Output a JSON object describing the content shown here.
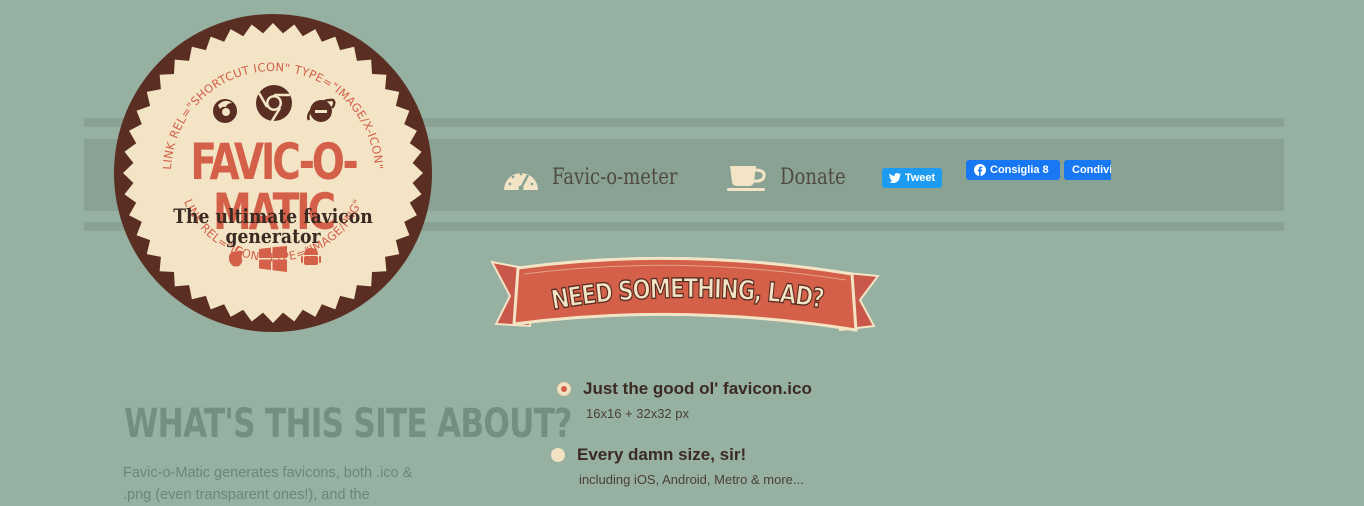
{
  "logo": {
    "title": "FAVIC-O-MATIC",
    "subtitle": "The ultimate favicon generator",
    "arc_top": "LINK REL=\"SHORTCUT ICON\"  TYPE=\"IMAGE/X-ICON\"",
    "arc_bottom": "LINK REL=\"ICON\"  TYPE=\"IMAGE/PNG\"",
    "browser_icons": [
      "firefox-icon",
      "chrome-icon",
      "ie-icon"
    ],
    "platform_icons": [
      "apple-icon",
      "windows-icon",
      "android-icon"
    ]
  },
  "nav": {
    "faviconometer": "Favic-o-meter",
    "donate": "Donate"
  },
  "social": {
    "tweet": "Tweet",
    "fb_like": "Consiglia 8",
    "fb_share": "Condivi"
  },
  "banner": {
    "text": "NEED SOMETHING, LAD?"
  },
  "about": {
    "title": "WHAT'S THIS SITE ABOUT?",
    "text": "Favic-o-Matic generates favicons, both .ico & .png (even transparent ones!), and the"
  },
  "options": [
    {
      "title": "Just the good ol' favicon.ico",
      "subtitle": "16x16 + 32x32 px",
      "selected": true
    },
    {
      "title": "Every damn size, sir!",
      "subtitle": "including iOS, Android, Metro & more...",
      "selected": false
    }
  ],
  "colors": {
    "background": "#96b0a2",
    "band": "#89a294",
    "accent": "#d4604a",
    "badge_dark": "#5a2e22",
    "badge_cream": "#f3e4c6"
  }
}
